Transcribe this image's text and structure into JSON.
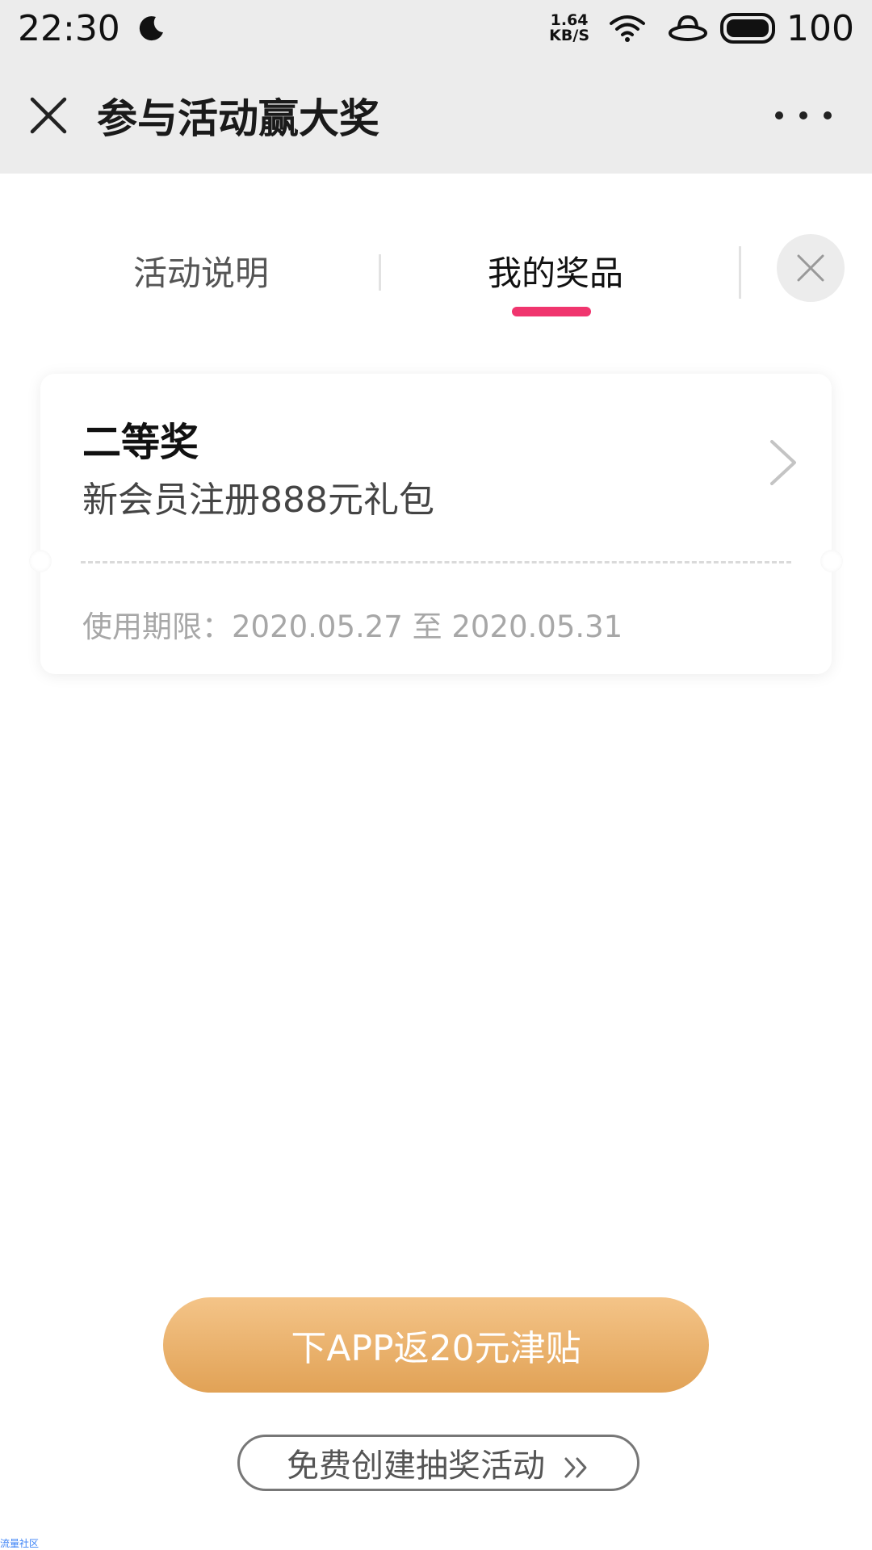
{
  "status_bar": {
    "time": "22:30",
    "net_speed_value": "1.64",
    "net_speed_unit": "KB/S",
    "battery": "100"
  },
  "nav": {
    "title": "参与活动赢大奖"
  },
  "tabs": [
    {
      "label": "活动说明",
      "active": false
    },
    {
      "label": "我的奖品",
      "active": true
    }
  ],
  "prize": {
    "level": "二等奖",
    "name": "新会员注册888元礼包",
    "validity": "使用期限：2020.05.27 至 2020.05.31"
  },
  "buttons": {
    "app": "下APP返20元津贴",
    "create": "免费创建抽奖活动"
  },
  "footer": {
    "watermark": "流量社区"
  },
  "colors": {
    "tab_underline": "#f0356e",
    "app_button_top": "#f4c488",
    "app_button_bottom": "#e1a256"
  },
  "icons": [
    "moon-icon",
    "wifi-icon",
    "ufo-icon",
    "battery-icon",
    "close-icon",
    "more-icon",
    "chevron-right-icon",
    "double-chevron-icon"
  ]
}
